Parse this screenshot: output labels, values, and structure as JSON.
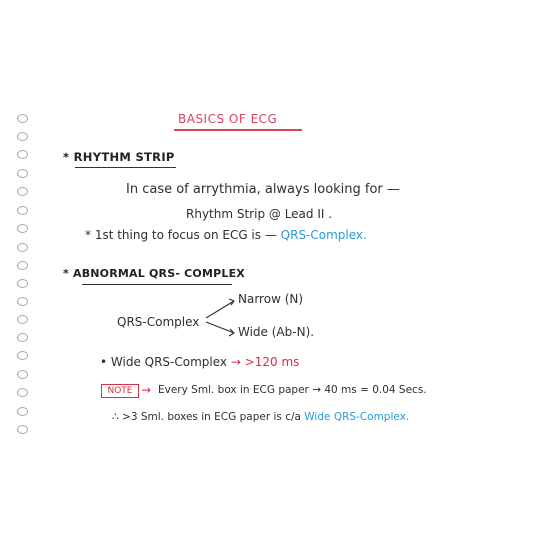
{
  "title": "BASICS OF ECG",
  "rhythm_strip": {
    "heading": "* RHYTHM STRIP",
    "line1": "In case of arrythmia, always looking for —",
    "line2": "Rhythm Strip @ Lead II .",
    "line3_prefix": "* 1st thing to focus on ECG is — ",
    "line3_highlight": "QRS-Complex."
  },
  "abnormal_qrs": {
    "heading": "* ABNORMAL QRS- COMPLEX",
    "qrs_label": "QRS-Complex",
    "narrow": "Narrow (N)",
    "wide": "Wide (Ab-N).",
    "wide_qrs_prefix": "• Wide QRS-Complex ",
    "wide_qrs_value": "→ >120 ms",
    "note_label": "NOTE",
    "note_arrow": "→",
    "note_text": "Every Sml. box in ECG paper → 40 ms = 0.04 Secs.",
    "therefore_prefix": "∴ >3 Sml. boxes in ECG paper is c/a ",
    "therefore_highlight": "Wide QRS-Complex."
  },
  "colors": {
    "title": "#d8455e",
    "highlight_blue": "#2a9ad8",
    "highlight_red": "#d62f43"
  }
}
